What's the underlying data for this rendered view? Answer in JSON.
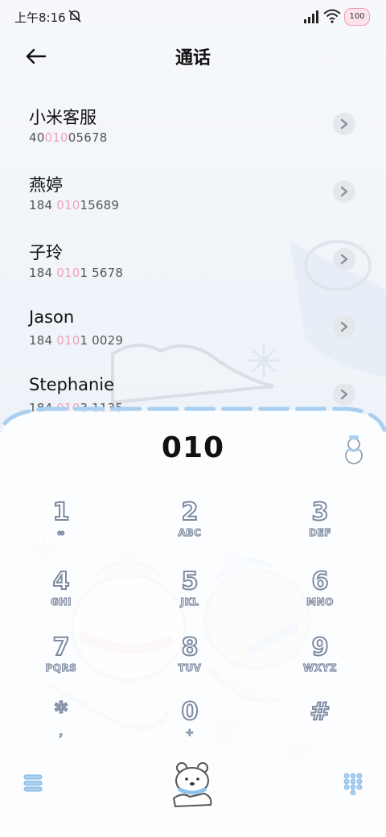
{
  "status_bar": {
    "time": "上午8:16",
    "battery": "100",
    "icons": [
      "mute-icon",
      "signal-icon",
      "wifi-icon",
      "battery-icon"
    ]
  },
  "header": {
    "title": "通话",
    "back_icon": "arrow-left-icon"
  },
  "contacts": [
    {
      "name": "小米客服",
      "number_pre": "40",
      "number_hl": "010",
      "number_post": "05678"
    },
    {
      "name": "燕婷",
      "number_pre": "184 ",
      "number_hl": "010",
      "number_post": "15689"
    },
    {
      "name": "子玲",
      "number_pre": "184 ",
      "number_hl": "010",
      "number_post": "1 5678"
    },
    {
      "name": "Jason",
      "number_pre": "184 ",
      "number_hl": "010",
      "number_post": "1 0029"
    },
    {
      "name": "Stephanie",
      "number_pre": "184 ",
      "number_hl": "010",
      "number_post": "3 1135"
    }
  ],
  "dialer": {
    "input_value": "010",
    "keys": [
      {
        "digit": "1",
        "letters": "∞"
      },
      {
        "digit": "2",
        "letters": "ABC"
      },
      {
        "digit": "3",
        "letters": "DEF"
      },
      {
        "digit": "4",
        "letters": "GHI"
      },
      {
        "digit": "5",
        "letters": "JKL"
      },
      {
        "digit": "6",
        "letters": "MNO"
      },
      {
        "digit": "7",
        "letters": "PQRS"
      },
      {
        "digit": "8",
        "letters": "TUV"
      },
      {
        "digit": "9",
        "letters": "WXYZ"
      },
      {
        "digit": "*",
        "letters": ","
      },
      {
        "digit": "0",
        "letters": "+"
      },
      {
        "digit": "#",
        "letters": ""
      }
    ]
  },
  "colors": {
    "highlight": "#f0a4bd",
    "accent_blue": "#8fc3ec",
    "key_stroke": "#7d8aa3"
  }
}
